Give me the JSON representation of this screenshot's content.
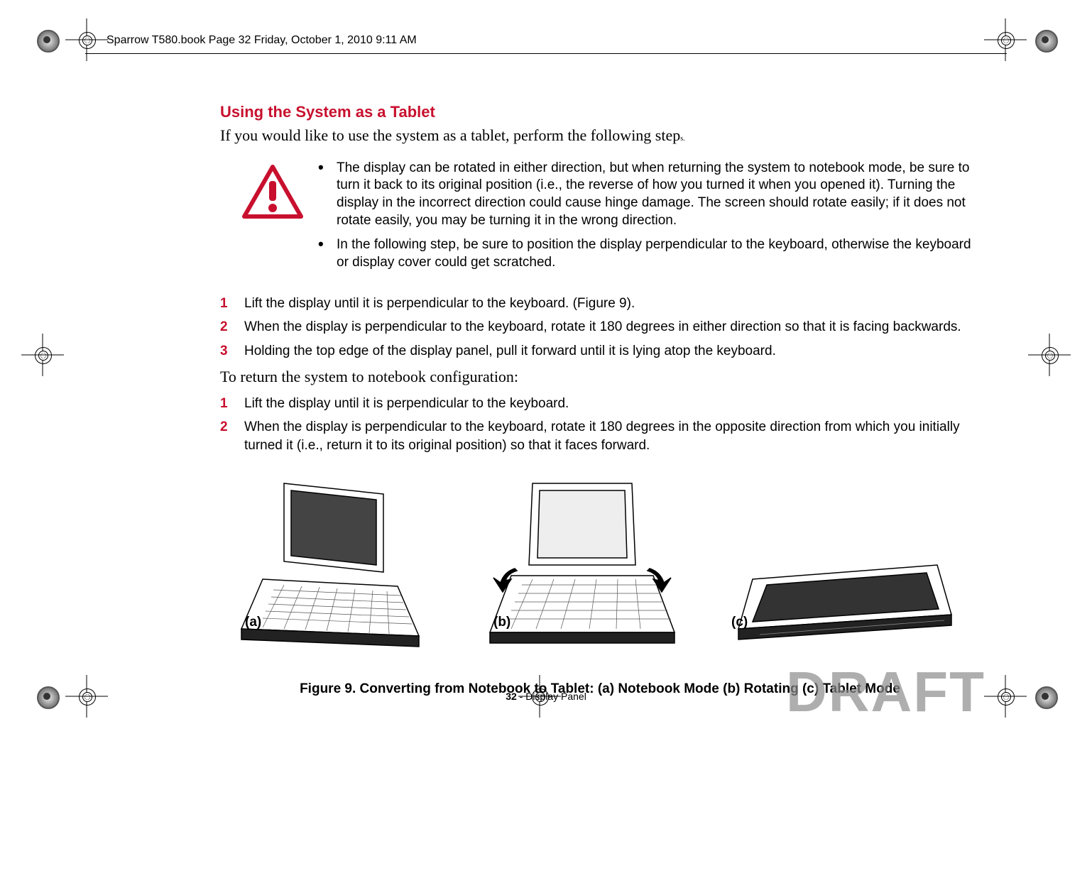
{
  "header": {
    "running_head": "Sparrow T580.book  Page 32  Friday, October 1, 2010  9:11 AM"
  },
  "section": {
    "heading": "Using the System as a Tablet",
    "intro_main": "If you would like to use the system as a tablet, perform the following step",
    "intro_sub": "s."
  },
  "warning": {
    "item1": "The display can be rotated in either direction, but when returning the system to notebook mode, be sure to turn it back to its original position (i.e., the reverse of how you turned it when you opened it). Turning the display in the incorrect direction could cause hinge damage. The screen should rotate easily; if it does not rotate easily, you may be turning it in the wrong direction.",
    "item2": "In the following step, be sure to position the display perpendicular to the keyboard, otherwise the keyboard or display cover could get scratched."
  },
  "steps1": {
    "s1": "Lift the display until it is perpendicular to the keyboard. (Figure 9).",
    "s2": "When the display is perpendicular to the keyboard, rotate it 180 degrees in either direction so that it is facing backwards.",
    "s3": "Holding the top edge of the display panel, pull it forward until it is lying atop the keyboard."
  },
  "return_heading": "To return the system to notebook configuration:",
  "steps2": {
    "s1": "Lift the display until it is perpendicular to the keyboard.",
    "s2": "When the display is perpendicular to the keyboard, rotate it 180 degrees in the opposite direction from which you initially turned it (i.e., return it to its original position) so that it faces forward."
  },
  "figure": {
    "label_a": "(a)",
    "label_b": "(b)",
    "label_c": "(c)",
    "caption": "Figure 9.  Converting from Notebook to Tablet: (a) Notebook Mode (b) Rotating (c) Tablet Mode"
  },
  "footer": {
    "page_number": "32",
    "section_name": " - Display Panel"
  },
  "watermark": "DRAFT",
  "numbers": {
    "n1": "1",
    "n2": "2",
    "n3": "3"
  },
  "bullet": "•"
}
